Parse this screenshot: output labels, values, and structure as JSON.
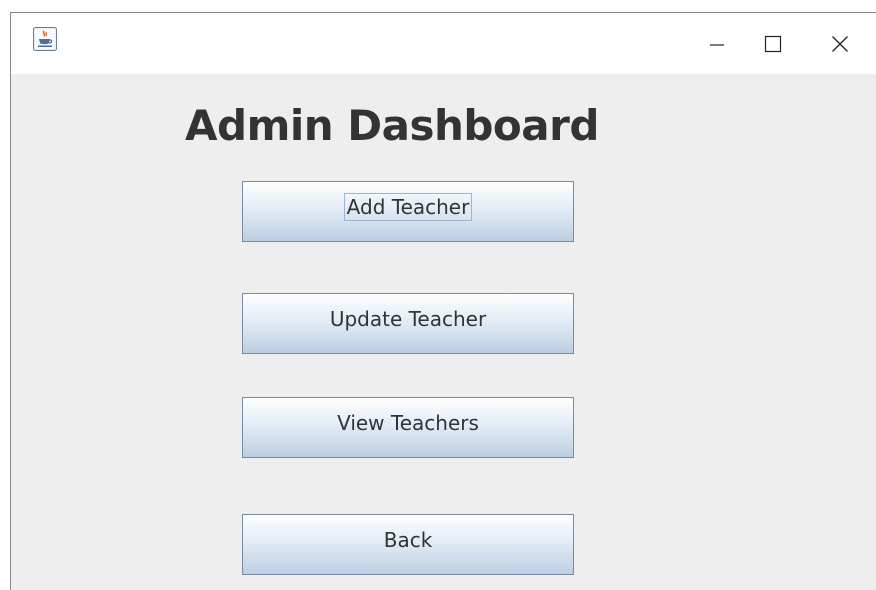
{
  "window": {
    "icon": "java-coffee-cup-icon",
    "controls": {
      "minimize_icon": "minimize-icon",
      "maximize_icon": "maximize-icon",
      "close_icon": "close-icon"
    }
  },
  "dashboard": {
    "title": "Admin Dashboard",
    "buttons": [
      {
        "label": "Add Teacher",
        "focused": true
      },
      {
        "label": "Update Teacher",
        "focused": false
      },
      {
        "label": "View Teachers",
        "focused": false
      },
      {
        "label": "Back",
        "focused": false
      }
    ]
  },
  "colors": {
    "background": "#eeeeee",
    "title_text": "#333333",
    "button_border": "#7a8aa0"
  }
}
